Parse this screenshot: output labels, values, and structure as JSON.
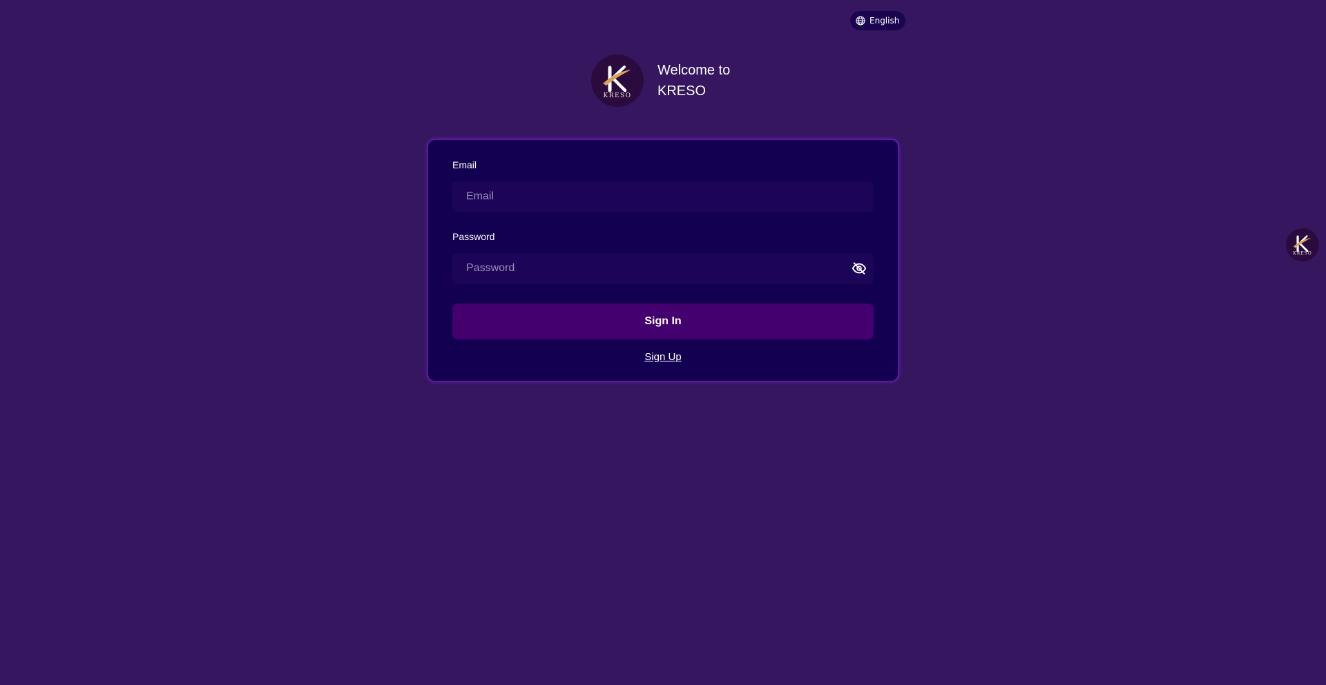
{
  "language": {
    "label": "English",
    "icon": "globe-icon"
  },
  "header": {
    "welcome_line1": "Welcome to",
    "welcome_line2": "KRESO",
    "logo_text": "KRESO"
  },
  "form": {
    "email_label": "Email",
    "email_placeholder": "Email",
    "email_value": "",
    "password_label": "Password",
    "password_placeholder": "Password",
    "password_value": "",
    "toggle_icon": "eye-off-icon",
    "signin_label": "Sign In",
    "signup_label": "Sign Up"
  },
  "floating": {
    "logo_text": "KRESO"
  },
  "colors": {
    "background": "#35165f",
    "card": "#140050",
    "card_border": "#5a1a9e",
    "input": "#1c0558",
    "primary_button": "#43006e",
    "logo_bg": "#2b0b3e",
    "logo_gold": "#d9a35b"
  }
}
